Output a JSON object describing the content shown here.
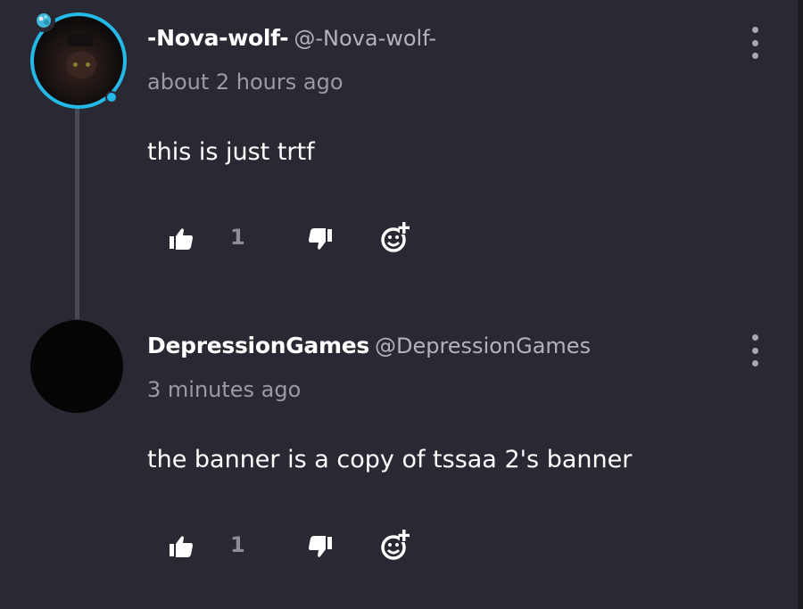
{
  "comments": [
    {
      "username": "-Nova-wolf-",
      "handle": "@-Nova-wolf-",
      "time": "about 2 hours ago",
      "text": "this is just trtf",
      "likes": "1"
    },
    {
      "username": "DepressionGames",
      "handle": "@DepressionGames",
      "time": "3 minutes ago",
      "text": "the banner is a copy of tssaa 2's banner",
      "likes": "1"
    }
  ],
  "colors": {
    "background": "#2a2933",
    "avatar_ring": "#25b9e8",
    "muted_text": "#9b99a6",
    "icon": "#ffffff"
  },
  "icons": {
    "like": "thumbs-up-icon",
    "dislike": "thumbs-down-icon",
    "react": "add-reaction-icon",
    "more": "more-vertical-icon"
  }
}
